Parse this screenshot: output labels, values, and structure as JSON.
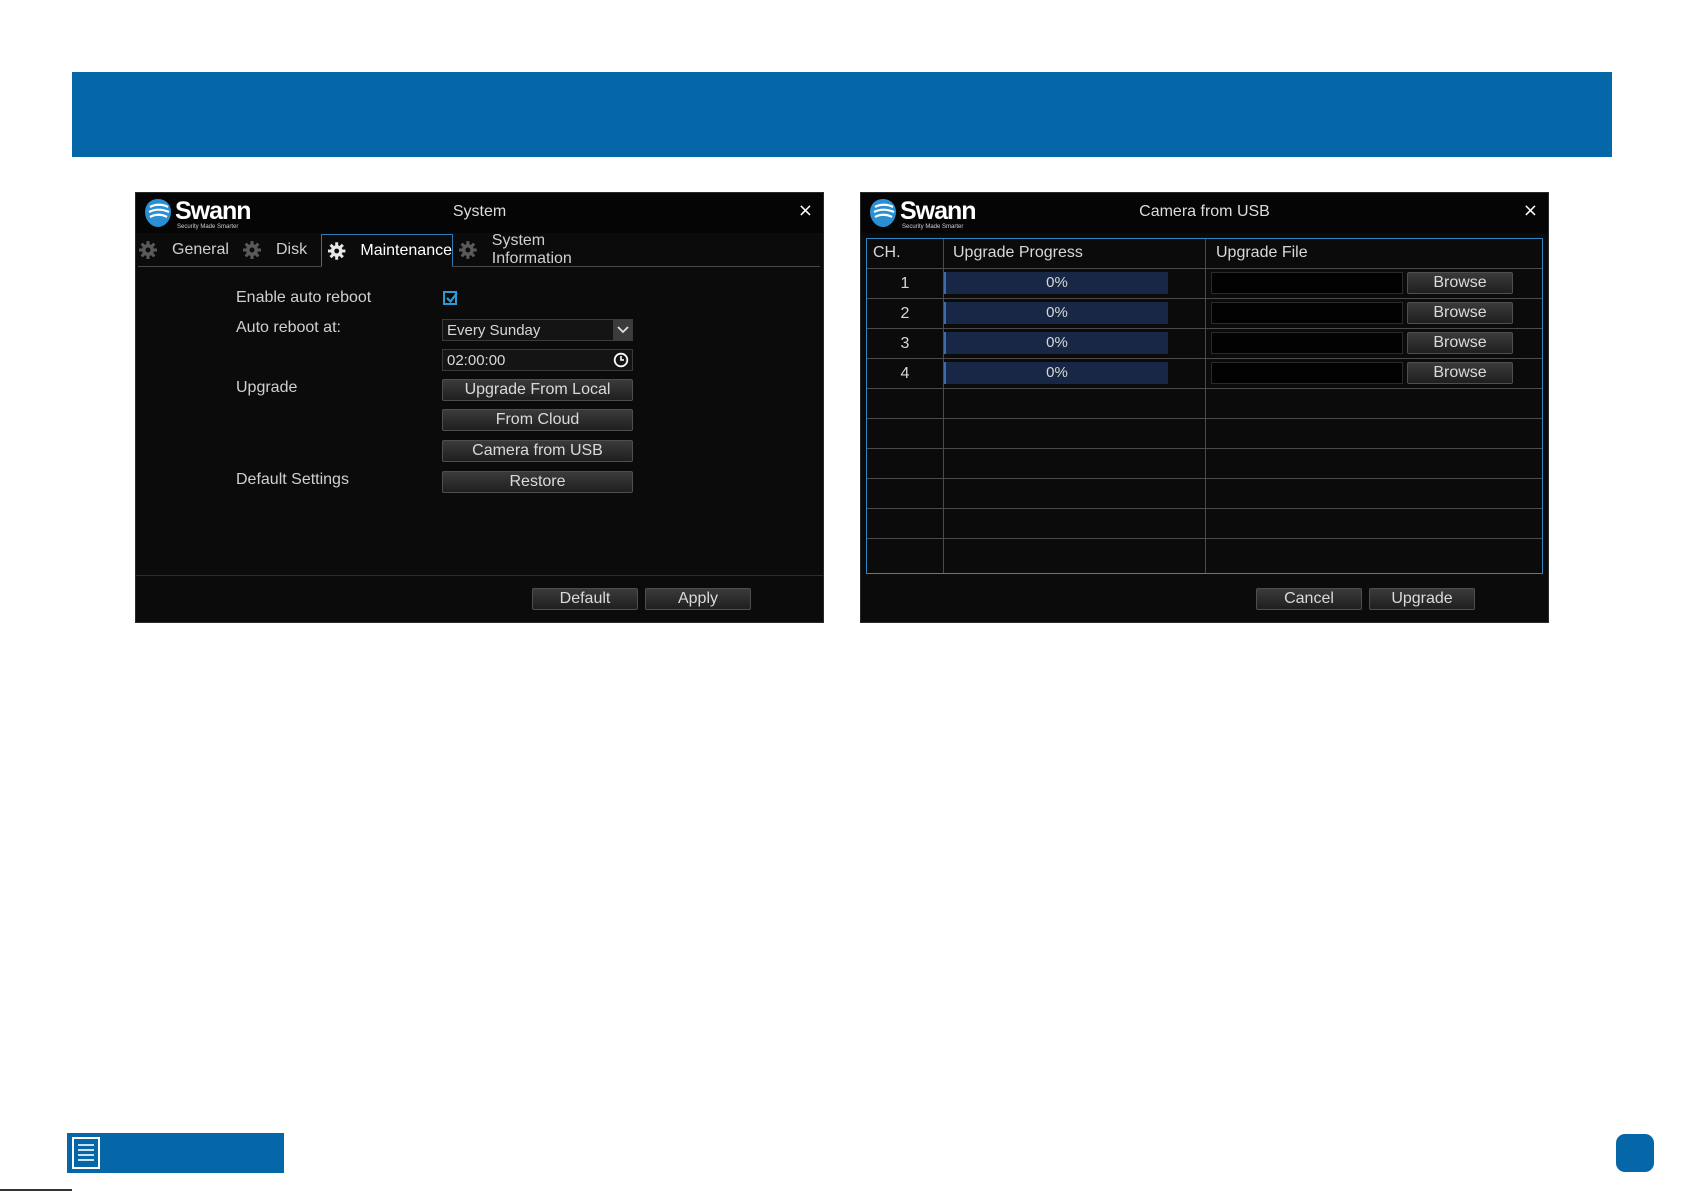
{
  "colors": {
    "brand_blue": "#0567a8",
    "panel_bg": "#0b0b0b",
    "accent_border": "#2f86c2",
    "progress_fill": "#182745"
  },
  "system_dialog": {
    "brand": "Swann",
    "tagline": "Security Made Smarter",
    "title": "System",
    "close": "×",
    "tabs": [
      {
        "label": "General",
        "icon": "gear-icon"
      },
      {
        "label": "Disk",
        "icon": "gear-icon"
      },
      {
        "label": "Maintenance",
        "icon": "gear-icon"
      },
      {
        "label": "System Information",
        "icon": "gear-icon"
      }
    ],
    "active_tab": "Maintenance",
    "enable_auto_reboot_label": "Enable auto reboot",
    "enable_auto_reboot_checked": true,
    "auto_reboot_at_label": "Auto reboot at:",
    "auto_reboot_day": "Every Sunday",
    "auto_reboot_time": "02:00:00",
    "upgrade_label": "Upgrade",
    "upgrade_from_local": "Upgrade From Local",
    "from_cloud": "From Cloud",
    "camera_from_usb": "Camera from USB",
    "default_settings_label": "Default Settings",
    "restore": "Restore",
    "default_button": "Default",
    "apply_button": "Apply"
  },
  "usb_dialog": {
    "brand": "Swann",
    "tagline": "Security Made Smarter",
    "title": "Camera from USB",
    "close": "×",
    "columns": [
      "CH.",
      "Upgrade Progress",
      "Upgrade File"
    ],
    "rows": [
      {
        "ch": "1",
        "progress": "0%",
        "file": "",
        "browse": "Browse"
      },
      {
        "ch": "2",
        "progress": "0%",
        "file": "",
        "browse": "Browse"
      },
      {
        "ch": "3",
        "progress": "0%",
        "file": "",
        "browse": "Browse"
      },
      {
        "ch": "4",
        "progress": "0%",
        "file": "",
        "browse": "Browse"
      }
    ],
    "empty_rows": 6,
    "cancel_button": "Cancel",
    "upgrade_button": "Upgrade"
  }
}
